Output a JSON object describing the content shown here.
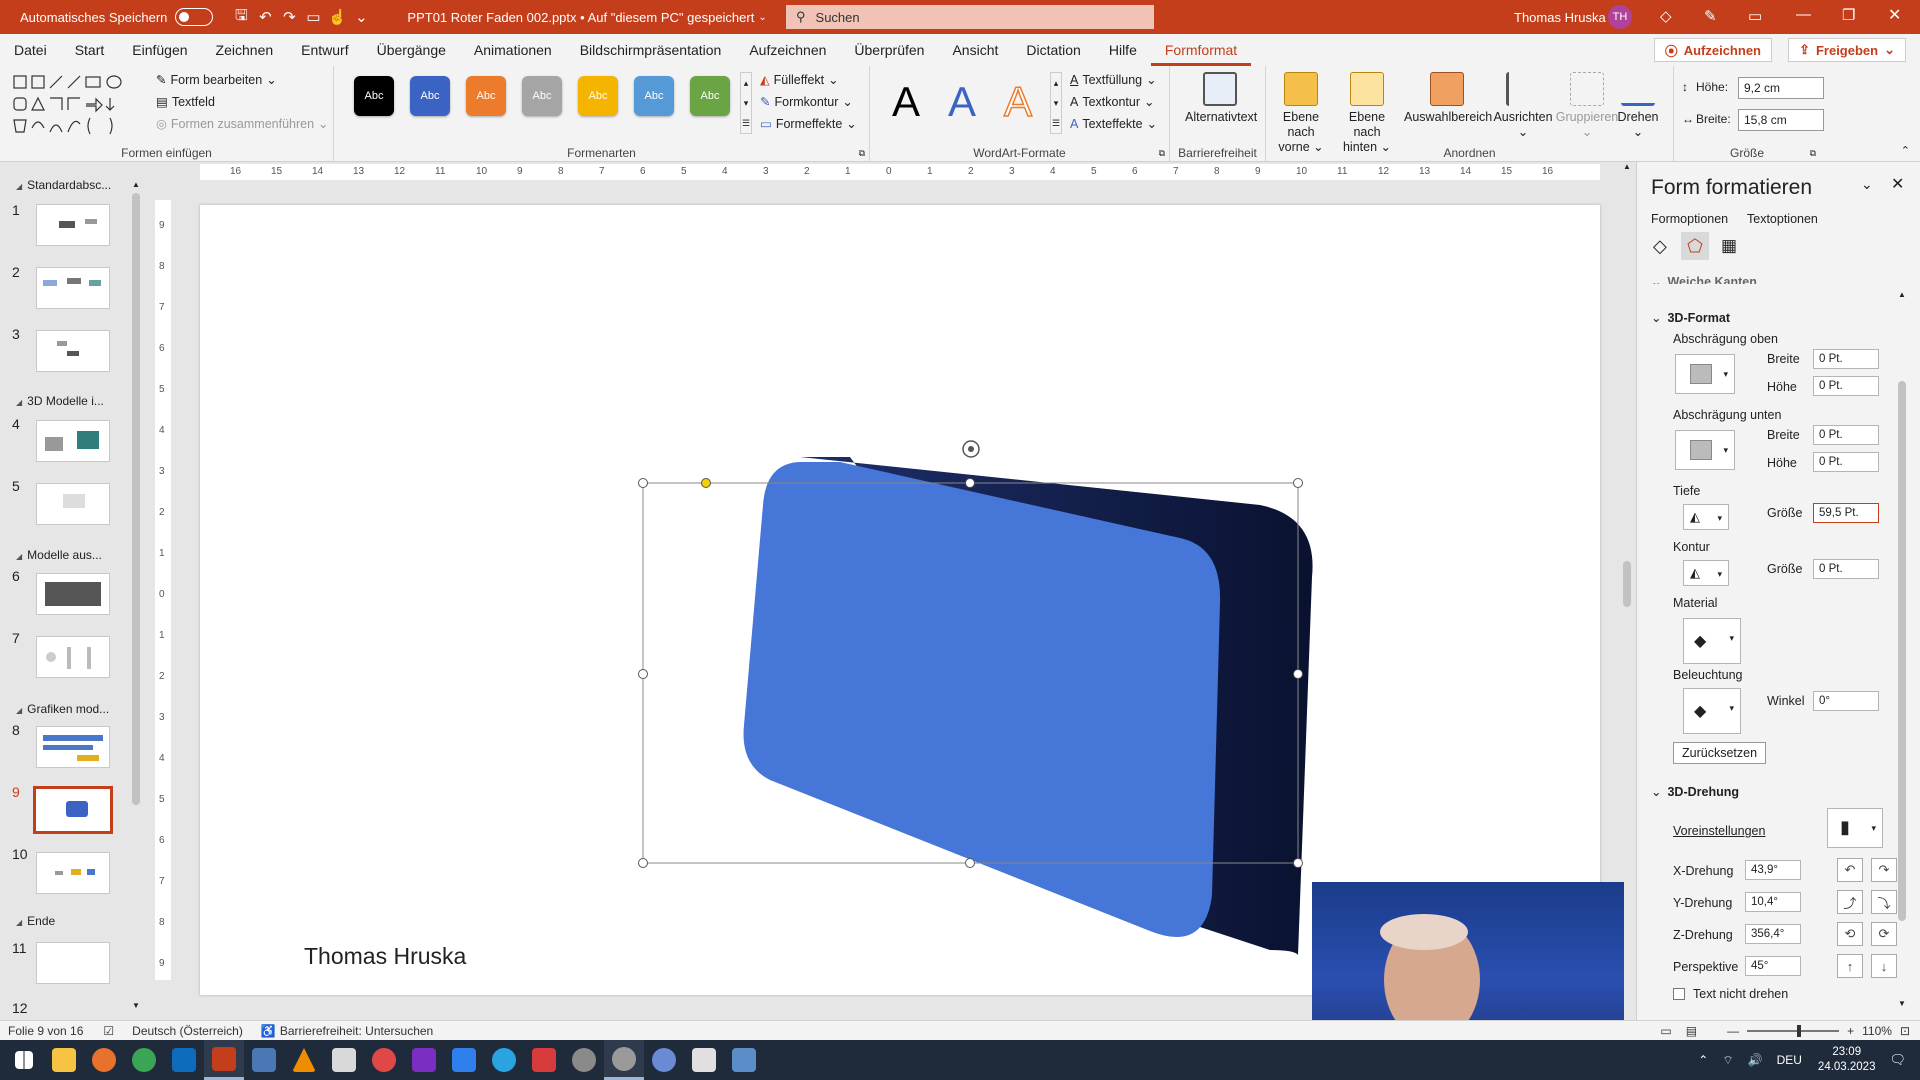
{
  "titlebar": {
    "autosave_label": "Automatisches Speichern",
    "document": "PPT01 Roter Faden 002.pptx • Auf \"diesem PC\" gespeichert",
    "search_placeholder": "Suchen",
    "user": "Thomas Hruska",
    "initials": "TH"
  },
  "menu": {
    "items": [
      "Datei",
      "Start",
      "Einfügen",
      "Zeichnen",
      "Entwurf",
      "Übergänge",
      "Animationen",
      "Bildschirmpräsentation",
      "Aufzeichnen",
      "Überprüfen",
      "Ansicht",
      "Dictation",
      "Hilfe",
      "Formformat"
    ],
    "active": "Formformat",
    "record": "Aufzeichnen",
    "share": "Freigeben"
  },
  "ribbon": {
    "insert_shapes": {
      "edit": "Form bearbeiten",
      "textbox": "Textfeld",
      "merge": "Formen zusammenführen",
      "label": "Formen einfügen"
    },
    "shape_styles": {
      "swatch_text": "Abc",
      "swatches": [
        "#000000",
        "#3b63c4",
        "#ec7c2c",
        "#a5a5a5",
        "#f5b400",
        "#559ad6",
        "#6aa444"
      ],
      "fill": "Fülleffekt",
      "outline": "Formkontur",
      "effects": "Formeffekte",
      "label": "Formenarten"
    },
    "wordart": {
      "letter": "A",
      "fill": "Textfüllung",
      "outline": "Textkontur",
      "effects": "Texteffekte",
      "label": "WordArt-Formate"
    },
    "accessibility": {
      "alt": "Alternativtext",
      "label": "Barrierefreiheit"
    },
    "arrange": {
      "forward_1": "Ebene nach",
      "forward_2": "vorne",
      "backward_1": "Ebene nach",
      "backward_2": "hinten",
      "selection": "Auswahlbereich",
      "align": "Ausrichten",
      "group": "Gruppieren",
      "rotate": "Drehen",
      "label": "Anordnen"
    },
    "size": {
      "height_label": "Höhe:",
      "height": "9,2 cm",
      "width_label": "Breite:",
      "width": "15,8 cm",
      "label": "Größe"
    }
  },
  "slides": {
    "sections": [
      "Standardabsc...",
      "3D Modelle i...",
      "Modelle aus...",
      "Grafiken mod...",
      "Ende"
    ],
    "numbers": [
      "1",
      "2",
      "3",
      "4",
      "5",
      "6",
      "7",
      "8",
      "9",
      "10",
      "11",
      "12"
    ],
    "selected": "9"
  },
  "ruler": {
    "h_ticks": [
      "16",
      "15",
      "14",
      "13",
      "12",
      "11",
      "10",
      "9",
      "8",
      "7",
      "6",
      "5",
      "4",
      "3",
      "2",
      "1",
      "0",
      "1",
      "2",
      "3",
      "4",
      "5",
      "6",
      "7",
      "8",
      "9",
      "10",
      "11",
      "12",
      "13",
      "14",
      "15",
      "16"
    ],
    "v_ticks": [
      "9",
      "8",
      "7",
      "6",
      "5",
      "4",
      "3",
      "2",
      "1",
      "0",
      "1",
      "2",
      "3",
      "4",
      "5",
      "6",
      "7",
      "8",
      "9"
    ]
  },
  "slide": {
    "author": "Thomas Hruska",
    "shape_color": "#4676d8"
  },
  "pane": {
    "title": "Form formatieren",
    "tab_shape": "Formoptionen",
    "tab_text": "Textoptionen",
    "soft_edges": "Weiche Kanten",
    "format3d": "3D-Format",
    "bevel_top": "Abschrägung oben",
    "bevel_bottom": "Abschrägung unten",
    "width": "Breite",
    "height": "Höhe",
    "bevel_top_width": "0 Pt.",
    "bevel_top_height": "0 Pt.",
    "bevel_bottom_width": "0 Pt.",
    "bevel_bottom_height": "0 Pt.",
    "depth": "Tiefe",
    "size": "Größe",
    "depth_size": "59,5 Pt.",
    "contour": "Kontur",
    "contour_size": "0 Pt.",
    "material": "Material",
    "lighting": "Beleuchtung",
    "angle": "Winkel",
    "angle_value": "0°",
    "reset": "Zurücksetzen",
    "rotation3d": "3D-Drehung",
    "presets": "Voreinstellungen",
    "x_rot": "X-Drehung",
    "x_val": "43,9°",
    "y_rot": "Y-Drehung",
    "y_val": "10,4°",
    "z_rot": "Z-Drehung",
    "z_val": "356,4°",
    "perspective": "Perspektive",
    "persp_val": "45°",
    "keep_text_flat": "Text nicht drehen"
  },
  "status": {
    "slide": "Folie 9 von 16",
    "language": "Deutsch (Österreich)",
    "accessibility": "Barrierefreiheit: Untersuchen",
    "zoom": "110%"
  },
  "taskbar": {
    "time": "23:09",
    "date": "24.03.2023",
    "lang": "DEU",
    "apps": [
      "#f6c343",
      "#e8712b",
      "#3aa655",
      "#0f6cbd",
      "#c43e1c",
      "#4a78b5",
      "#f08c00",
      "#e04848",
      "#d9d9d9",
      "#7b2fc2",
      "#2f80ed",
      "#2aa4e0",
      "#d83b3b",
      "#8a8a8a",
      "#9a9a9a",
      "#6a8ad6",
      "#e0e0e0",
      "#5b8ec9"
    ]
  }
}
